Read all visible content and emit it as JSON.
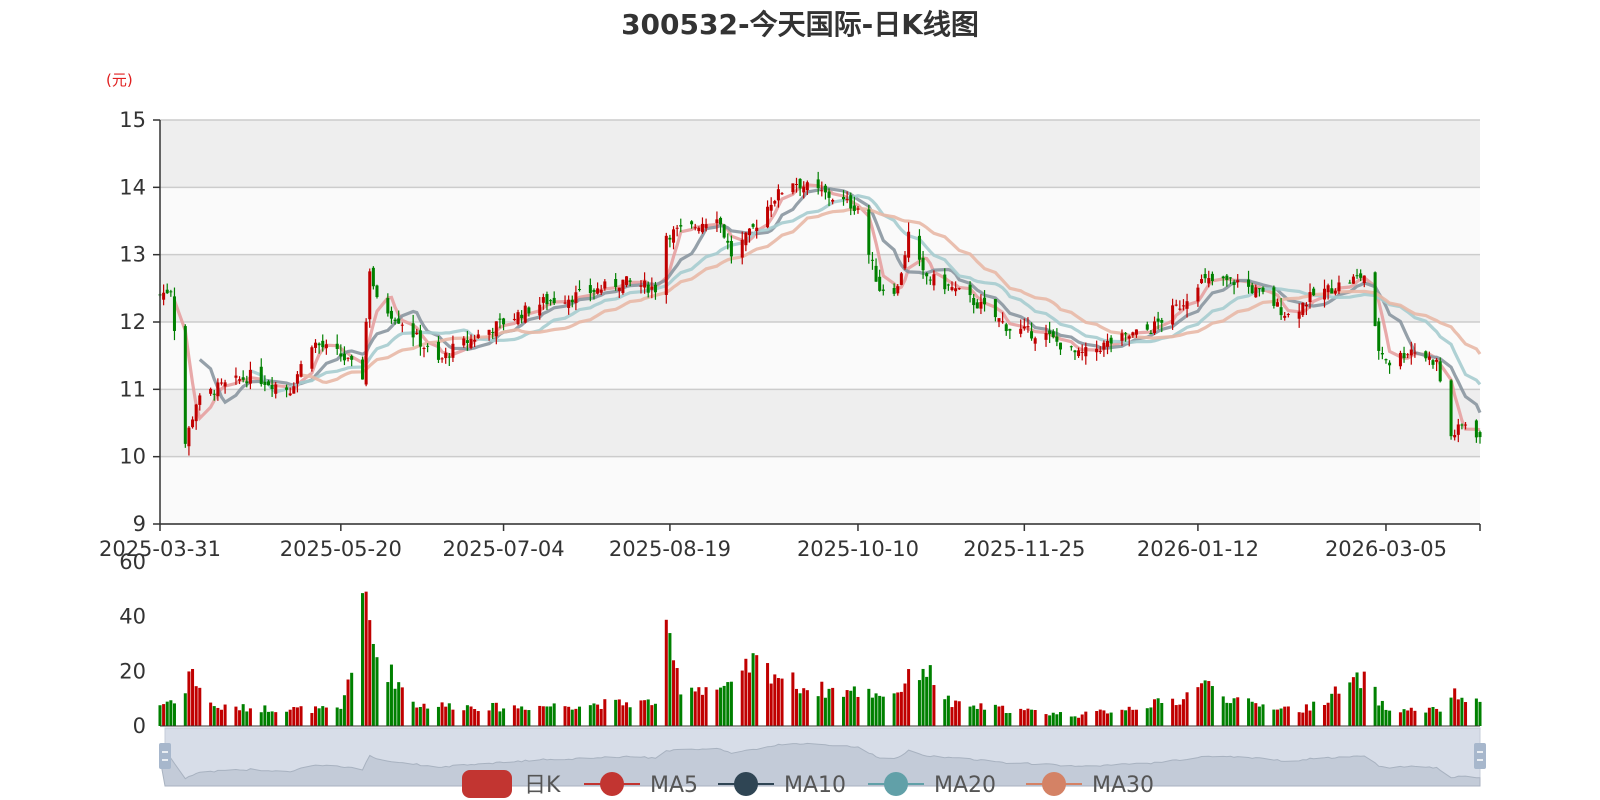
{
  "chart_data": {
    "type": "candlestick",
    "title": "300532-今天国际-日K线图",
    "y_unit": "(元)",
    "ylim": [
      9,
      15
    ],
    "y_ticks": [
      "9",
      "10",
      "11",
      "12",
      "13",
      "14",
      "15"
    ],
    "x_range": [
      "2025-03-31",
      "2026-03-31"
    ],
    "x_ticks": [
      "2025-03-31",
      "2025-05-20",
      "2025-07-04",
      "2025-08-19",
      "2025-10-10",
      "2025-11-25",
      "2026-01-12",
      "2026-03-05"
    ],
    "volume_ylim": [
      0,
      60
    ],
    "volume_ticks": [
      "0",
      "20",
      "40",
      "60"
    ],
    "legend": [
      {
        "name": "日K",
        "color": "#c23531"
      },
      {
        "name": "MA5",
        "color": "#c23531"
      },
      {
        "name": "MA10",
        "color": "#2f4554"
      },
      {
        "name": "MA20",
        "color": "#61a0a8"
      },
      {
        "name": "MA30",
        "color": "#d48265"
      }
    ],
    "colors": {
      "up": "#c00000",
      "down": "#008000"
    },
    "close_keypoints": [
      [
        "2025-03-31",
        12.4
      ],
      [
        "2025-04-03",
        12.5
      ],
      [
        "2025-04-07",
        10.2
      ],
      [
        "2025-04-10",
        10.8
      ],
      [
        "2025-04-15",
        11.0
      ],
      [
        "2025-04-25",
        11.2
      ],
      [
        "2025-05-06",
        11.0
      ],
      [
        "2025-05-12",
        11.7
      ],
      [
        "2025-05-20",
        11.5
      ],
      [
        "2025-05-26",
        11.2
      ],
      [
        "2025-05-28",
        12.8
      ],
      [
        "2025-05-30",
        12.3
      ],
      [
        "2025-06-06",
        12.0
      ],
      [
        "2025-06-16",
        11.4
      ],
      [
        "2025-06-20",
        11.6
      ],
      [
        "2025-07-04",
        12.0
      ],
      [
        "2025-07-15",
        12.3
      ],
      [
        "2025-07-25",
        12.4
      ],
      [
        "2025-08-06",
        12.6
      ],
      [
        "2025-08-15",
        12.5
      ],
      [
        "2025-08-18",
        13.3
      ],
      [
        "2025-08-25",
        13.4
      ],
      [
        "2025-09-01",
        13.6
      ],
      [
        "2025-09-05",
        13.0
      ],
      [
        "2025-09-10",
        13.3
      ],
      [
        "2025-09-16",
        13.8
      ],
      [
        "2025-09-22",
        14.1
      ],
      [
        "2025-09-26",
        14.0
      ],
      [
        "2025-10-10",
        13.7
      ],
      [
        "2025-10-13",
        13.0
      ],
      [
        "2025-10-16",
        12.5
      ],
      [
        "2025-10-21",
        12.5
      ],
      [
        "2025-10-24",
        13.3
      ],
      [
        "2025-10-28",
        12.7
      ],
      [
        "2025-11-05",
        12.5
      ],
      [
        "2025-11-14",
        12.2
      ],
      [
        "2025-11-21",
        11.9
      ],
      [
        "2025-12-01",
        11.8
      ],
      [
        "2025-12-10",
        11.5
      ],
      [
        "2025-12-19",
        11.7
      ],
      [
        "2025-12-30",
        11.9
      ],
      [
        "2026-01-08",
        12.3
      ],
      [
        "2026-01-12",
        12.6
      ],
      [
        "2026-01-23",
        12.6
      ],
      [
        "2026-01-30",
        12.4
      ],
      [
        "2026-02-06",
        12.1
      ],
      [
        "2026-02-13",
        12.4
      ],
      [
        "2026-02-27",
        12.7
      ],
      [
        "2026-03-03",
        11.6
      ],
      [
        "2026-03-06",
        11.4
      ],
      [
        "2026-03-12",
        11.6
      ],
      [
        "2026-03-19",
        11.4
      ],
      [
        "2026-03-23",
        10.3
      ],
      [
        "2026-03-27",
        10.5
      ],
      [
        "2026-03-31",
        10.3
      ]
    ],
    "volume_keypoints": [
      [
        "2025-03-31",
        8
      ],
      [
        "2025-04-07",
        12
      ],
      [
        "2025-04-08",
        21
      ],
      [
        "2025-04-15",
        7
      ],
      [
        "2025-05-20",
        6
      ],
      [
        "2025-05-27",
        47
      ],
      [
        "2025-05-28",
        38
      ],
      [
        "2025-05-30",
        26
      ],
      [
        "2025-06-10",
        8
      ],
      [
        "2025-07-04",
        7
      ],
      [
        "2025-08-15",
        9
      ],
      [
        "2025-08-18",
        33
      ],
      [
        "2025-08-22",
        15
      ],
      [
        "2025-09-05",
        14
      ],
      [
        "2025-09-11",
        24
      ],
      [
        "2025-09-26",
        14
      ],
      [
        "2025-10-20",
        12
      ],
      [
        "2025-10-28",
        23
      ],
      [
        "2025-11-05",
        8
      ],
      [
        "2025-12-10",
        4
      ],
      [
        "2026-01-08",
        10
      ],
      [
        "2026-01-12",
        17
      ],
      [
        "2026-01-23",
        9
      ],
      [
        "2026-02-10",
        6
      ],
      [
        "2026-02-27",
        18
      ],
      [
        "2026-03-05",
        6
      ],
      [
        "2026-03-20",
        6
      ],
      [
        "2026-03-23",
        12
      ],
      [
        "2026-03-31",
        8
      ]
    ]
  }
}
